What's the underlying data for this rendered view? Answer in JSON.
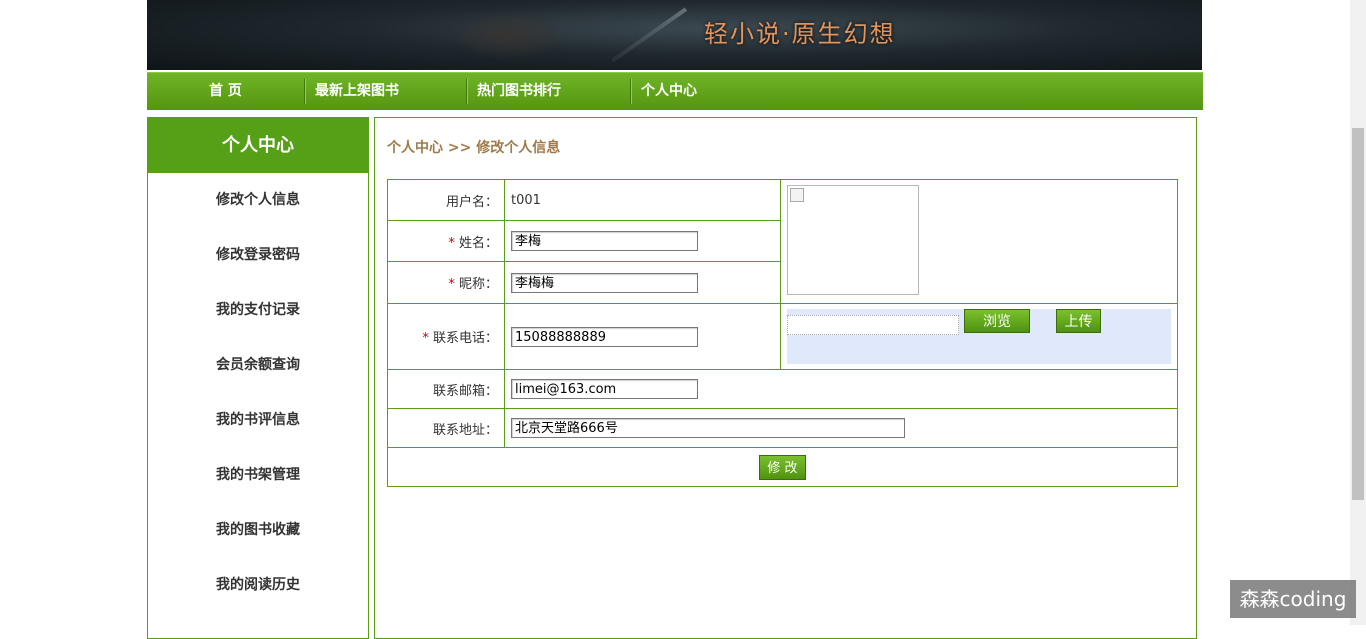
{
  "banner": {
    "title": "轻小说·原生幻想"
  },
  "nav": {
    "items": [
      "首 页",
      "最新上架图书",
      "热门图书排行",
      "个人中心"
    ]
  },
  "sidebar": {
    "title": "个人中心",
    "items": [
      "修改个人信息",
      "修改登录密码",
      "我的支付记录",
      "会员余额查询",
      "我的书评信息",
      "我的书架管理",
      "我的图书收藏",
      "我的阅读历史"
    ]
  },
  "breadcrumb": "个人中心 >> 修改个人信息",
  "form": {
    "required_mark": "*",
    "username_label": "用户名：",
    "username_value": "t001",
    "name_label": "姓名：",
    "name_value": "李梅",
    "nickname_label": "昵称：",
    "nickname_value": "李梅梅",
    "phone_label": "联系电话：",
    "phone_value": "15088888889",
    "email_label": "联系邮箱：",
    "email_value": "limei@163.com",
    "address_label": "联系地址：",
    "address_value": "北京天堂路666号",
    "browse_label": "浏览",
    "upload_label": "上传",
    "submit_label": "修 改"
  },
  "watermark": "森森coding",
  "colors": {
    "nav_green": "#5aa21a",
    "border_green": "#5a9d19",
    "breadcrumb": "#a07a4a",
    "banner_title": "#e2945a"
  }
}
